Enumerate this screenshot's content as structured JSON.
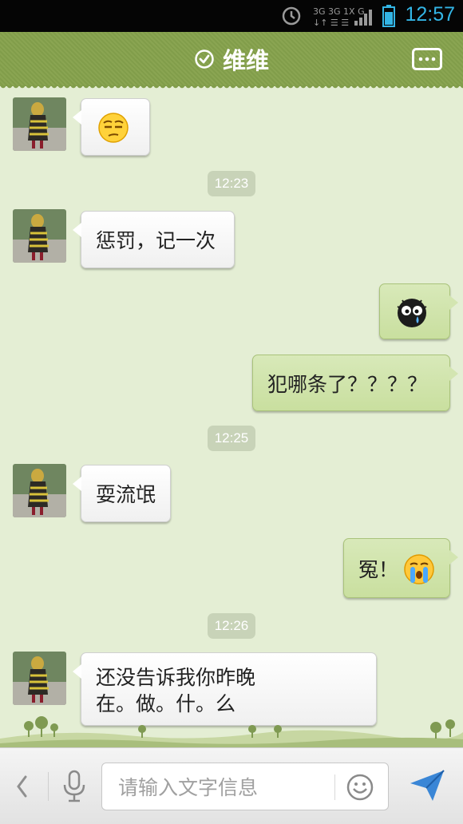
{
  "status_bar": {
    "time": "12:57",
    "icons": [
      "alarm-icon",
      "network-3g-icon",
      "signal-icon",
      "battery-icon"
    ],
    "accent_color": "#33b5e5"
  },
  "header": {
    "title": "维维",
    "icons": [
      "online-check-icon",
      "more-menu-icon"
    ]
  },
  "messages": [
    {
      "direction": "incoming",
      "type": "emoji",
      "emoji": "smirk-emoji"
    },
    {
      "direction": "timestamp",
      "text": "12:23"
    },
    {
      "direction": "incoming",
      "type": "text",
      "text": "惩罚，记一次"
    },
    {
      "direction": "outgoing",
      "type": "emoji",
      "emoji": "crying-bug-emoji"
    },
    {
      "direction": "outgoing",
      "type": "text",
      "text": "犯哪条了？？？？"
    },
    {
      "direction": "timestamp",
      "text": "12:25"
    },
    {
      "direction": "incoming",
      "type": "text",
      "text": "耍流氓"
    },
    {
      "direction": "outgoing",
      "type": "text",
      "text": "冤！",
      "emoji": "crying-face-emoji"
    },
    {
      "direction": "timestamp",
      "text": "12:26"
    },
    {
      "direction": "incoming",
      "type": "text",
      "lines": [
        "还没告诉我你昨晚",
        "在。做。什。么"
      ]
    }
  ],
  "input_bar": {
    "placeholder": "请输入文字信息",
    "icons": [
      "back-chevron-icon",
      "microphone-icon",
      "emoji-icon",
      "send-icon"
    ]
  },
  "colors": {
    "header_green": "#8aa552",
    "chat_background": "#e4eed4",
    "outgoing_bubble": "#d3e5b1",
    "incoming_bubble": "#ffffff"
  }
}
